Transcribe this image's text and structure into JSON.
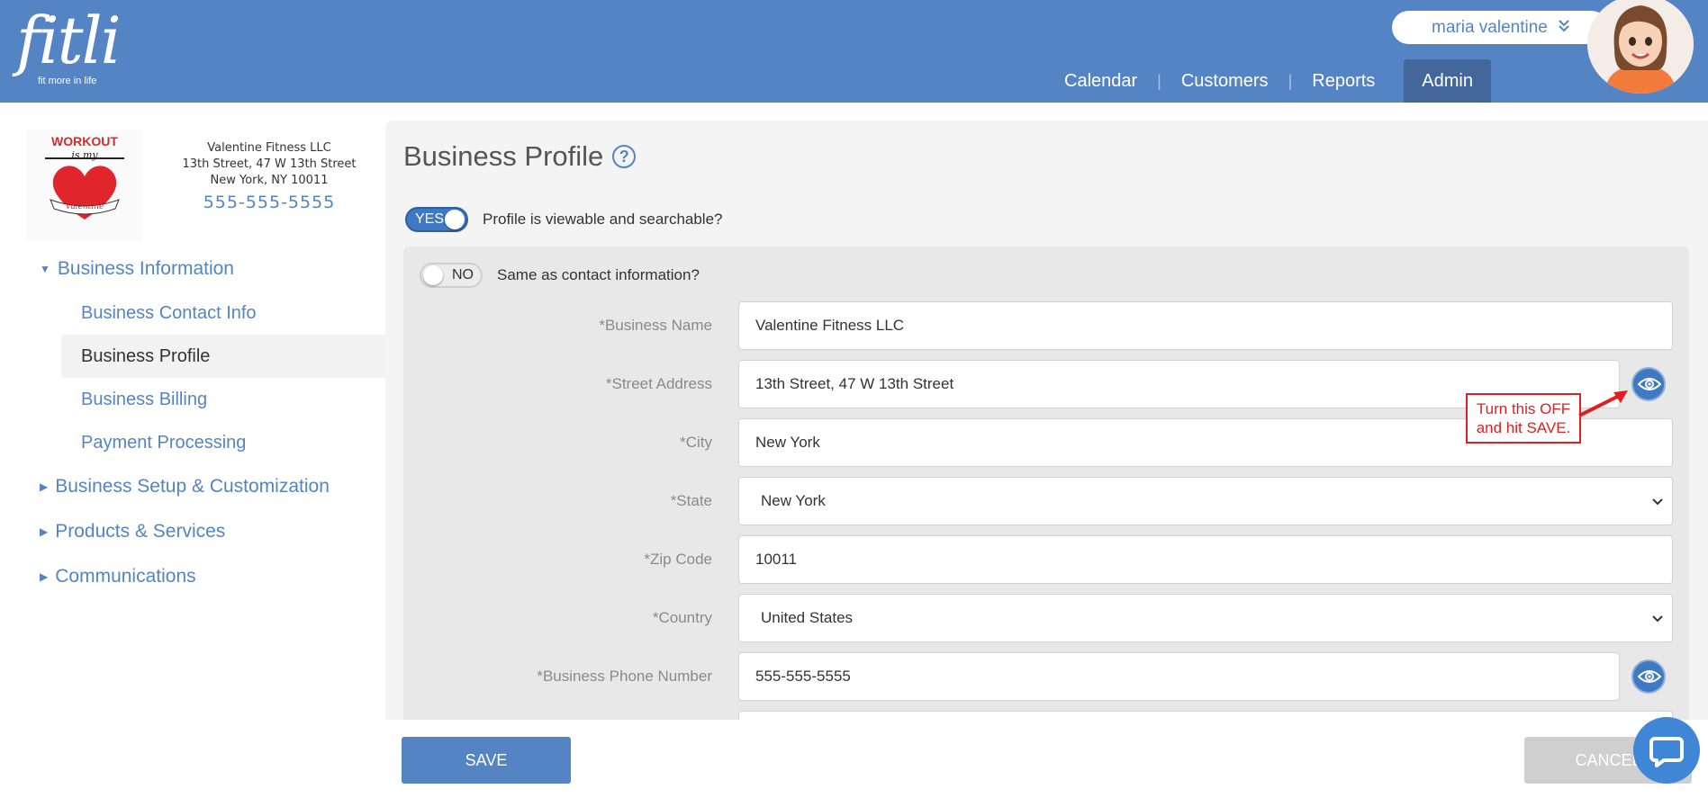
{
  "header": {
    "logo_text": "fitli",
    "logo_tagline": "fit more in life",
    "user_name": "maria valentine",
    "nav": [
      {
        "label": "Calendar"
      },
      {
        "label": "Customers"
      },
      {
        "label": "Reports"
      },
      {
        "label": "Admin",
        "active": true
      }
    ]
  },
  "business": {
    "logo_lines": [
      "WORKOUT",
      "is my",
      "Valentine"
    ],
    "name": "Valentine Fitness LLC",
    "street": "13th Street, 47 W 13th Street",
    "city_line": "New York, NY 10011",
    "phone": "555-555-5555"
  },
  "sidebar": {
    "sections": [
      {
        "label": "Business Information",
        "expanded": true,
        "items": [
          {
            "label": "Business Contact Info"
          },
          {
            "label": "Business Profile",
            "active": true
          },
          {
            "label": "Business Billing"
          },
          {
            "label": "Payment Processing"
          }
        ]
      },
      {
        "label": "Business Setup & Customization",
        "expanded": false
      },
      {
        "label": "Products & Services",
        "expanded": false
      },
      {
        "label": "Communications",
        "expanded": false
      }
    ]
  },
  "main": {
    "title": "Business Profile",
    "help_symbol": "?",
    "profile_toggle": {
      "state": "YES",
      "label": "Profile is viewable and searchable?"
    },
    "same_as_contact_toggle": {
      "state": "NO",
      "label": "Same as contact information?"
    },
    "fields": [
      {
        "label": "*Business Name",
        "value": "Valentine Fitness LLC",
        "type": "text"
      },
      {
        "label": "*Street Address",
        "value": "13th Street, 47 W 13th Street",
        "type": "text"
      },
      {
        "label": "*City",
        "value": "New York",
        "type": "text"
      },
      {
        "label": "*State",
        "value": "New York",
        "type": "select"
      },
      {
        "label": "*Zip Code",
        "value": "10011",
        "type": "text"
      },
      {
        "label": "*Country",
        "value": "United States",
        "type": "select"
      },
      {
        "label": "*Business Phone Number",
        "value": "555-555-5555",
        "type": "text"
      }
    ],
    "callout_lines": [
      "Turn this OFF",
      "and hit SAVE."
    ]
  },
  "footer": {
    "save_label": "SAVE",
    "cancel_label": "CANCEL"
  },
  "colors": {
    "brand_blue": "#5584c4",
    "nav_active": "#43679b",
    "toggle_on": "#3f79c2",
    "callout_red": "#e02020"
  },
  "icons": [
    "help-icon",
    "chevron-down-icon",
    "caret-down-icon",
    "caret-right-icon",
    "eye-icon",
    "chat-icon"
  ]
}
